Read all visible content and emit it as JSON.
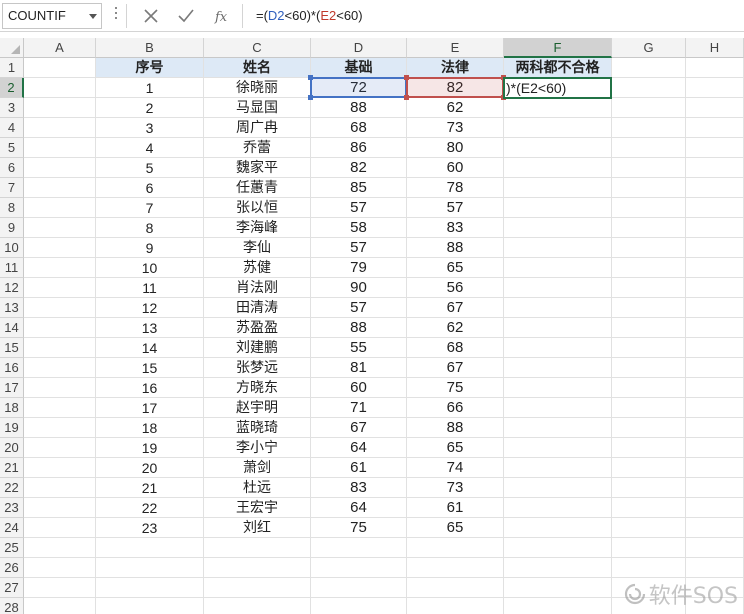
{
  "formula_bar": {
    "name_box": "COUNTIF",
    "formula_parts": [
      "=(",
      "D2",
      "<60)*(",
      "E2",
      "<60)"
    ]
  },
  "columns": [
    "A",
    "B",
    "C",
    "D",
    "E",
    "F",
    "G",
    "H"
  ],
  "row_count": 28,
  "headers": [
    "序号",
    "姓名",
    "基础",
    "法律",
    "两科都不合格"
  ],
  "records": [
    [
      "1",
      "徐晓丽",
      "72",
      "82"
    ],
    [
      "2",
      "马显国",
      "88",
      "62"
    ],
    [
      "3",
      "周广冉",
      "68",
      "73"
    ],
    [
      "4",
      "乔蕾",
      "86",
      "80"
    ],
    [
      "5",
      "魏家平",
      "82",
      "60"
    ],
    [
      "6",
      "任蕙青",
      "85",
      "78"
    ],
    [
      "7",
      "张以恒",
      "57",
      "57"
    ],
    [
      "8",
      "李海峰",
      "58",
      "83"
    ],
    [
      "9",
      "李仙",
      "57",
      "88"
    ],
    [
      "10",
      "苏健",
      "79",
      "65"
    ],
    [
      "11",
      "肖法刚",
      "90",
      "56"
    ],
    [
      "12",
      "田清涛",
      "57",
      "67"
    ],
    [
      "13",
      "苏盈盈",
      "88",
      "62"
    ],
    [
      "14",
      "刘建鹏",
      "55",
      "68"
    ],
    [
      "15",
      "张梦远",
      "81",
      "67"
    ],
    [
      "16",
      "方晓东",
      "60",
      "75"
    ],
    [
      "17",
      "赵宇明",
      "71",
      "66"
    ],
    [
      "18",
      "蓝晓琦",
      "67",
      "88"
    ],
    [
      "19",
      "李小宁",
      "64",
      "65"
    ],
    [
      "20",
      "萧剑",
      "61",
      "74"
    ],
    [
      "21",
      "杜远",
      "83",
      "73"
    ],
    [
      "22",
      "王宏宇",
      "64",
      "61"
    ],
    [
      "23",
      "刘红",
      "75",
      "65"
    ]
  ],
  "active_cell": "F2",
  "editing_text": ")*(E2<60)",
  "watermark": "软件SOS",
  "colors": {
    "header_fill": "#dde9f6",
    "ref_d": "#4472c4",
    "ref_e": "#c0504d",
    "active_border": "#217346"
  }
}
